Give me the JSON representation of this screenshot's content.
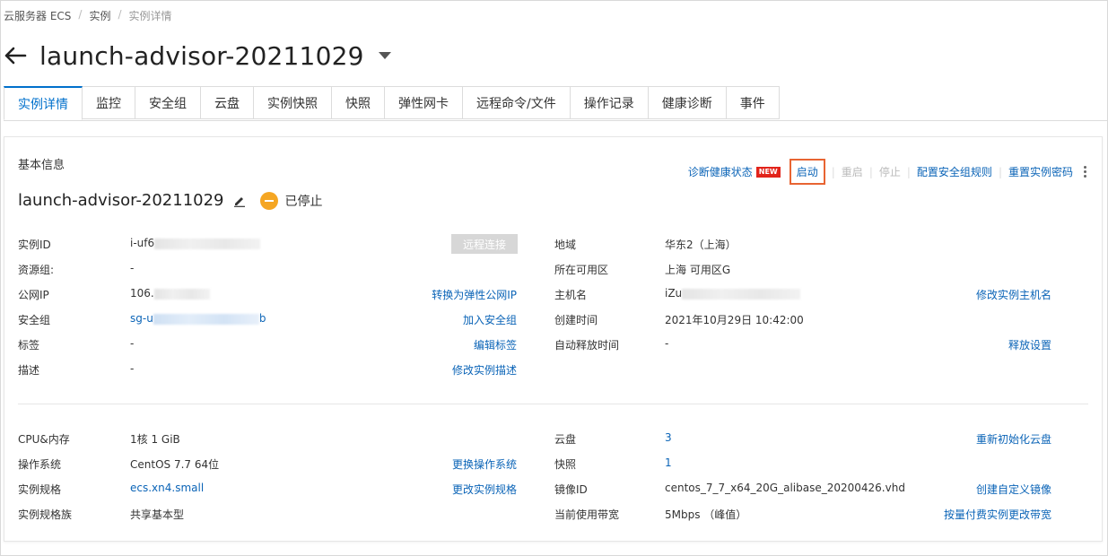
{
  "breadcrumb": [
    "云服务器 ECS",
    "实例",
    "实例详情"
  ],
  "page_title": "launch-advisor-20211029",
  "tabs": [
    "实例详情",
    "监控",
    "安全组",
    "云盘",
    "实例快照",
    "快照",
    "弹性网卡",
    "远程命令/文件",
    "操作记录",
    "健康诊断",
    "事件"
  ],
  "panel": {
    "title": "基本信息",
    "actions": {
      "diagnose": "诊断健康状态",
      "new_badge": "NEW",
      "start": "启动",
      "restart": "重启",
      "stop": "停止",
      "config_sg": "配置安全组规则",
      "reset_pwd": "重置实例密码"
    },
    "instance_name": "launch-advisor-20211029",
    "status": "已停止",
    "remote_connect": "远程连接",
    "left": {
      "instance_id_label": "实例ID",
      "instance_id_value": "i-uf6",
      "resource_group_label": "资源组:",
      "resource_group_value": "-",
      "public_ip_label": "公网IP",
      "public_ip_value": "106.",
      "public_ip_action": "转换为弹性公网IP",
      "sg_label": "安全组",
      "sg_value_prefix": "sg-u",
      "sg_value_suffix": "b",
      "sg_action": "加入安全组",
      "tag_label": "标签",
      "tag_value": "-",
      "tag_action": "编辑标签",
      "desc_label": "描述",
      "desc_value": "-",
      "desc_action": "修改实例描述"
    },
    "right": {
      "region_label": "地域",
      "region_value": "华东2（上海）",
      "zone_label": "所在可用区",
      "zone_value": "上海 可用区G",
      "hostname_label": "主机名",
      "hostname_value": "iZu",
      "hostname_action": "修改实例主机名",
      "created_label": "创建时间",
      "created_value": "2021年10月29日 10:42:00",
      "release_label": "自动释放时间",
      "release_value": "-",
      "release_action": "释放设置"
    },
    "spec_left": {
      "cpu_label": "CPU&内存",
      "cpu_value": "1核 1 GiB",
      "os_label": "操作系统",
      "os_value": "CentOS 7.7 64位",
      "os_action": "更换操作系统",
      "type_label": "实例规格",
      "type_value": "ecs.xn4.small",
      "type_action": "更改实例规格",
      "family_label": "实例规格族",
      "family_value": "共享基本型"
    },
    "spec_right": {
      "disk_label": "云盘",
      "disk_value": "3",
      "disk_action": "重新初始化云盘",
      "snapshot_label": "快照",
      "snapshot_value": "1",
      "image_label": "镜像ID",
      "image_value": "centos_7_7_x64_20G_alibase_20200426.vhd",
      "image_action": "创建自定义镜像",
      "bw_label": "当前使用带宽",
      "bw_value": "5Mbps （峰值）",
      "bw_action": "按量付费实例更改带宽"
    }
  },
  "colors": {
    "link": "#0b64b7",
    "active_tab": "#0070cc",
    "highlight": "#e86432",
    "status": "#f5a623",
    "new_badge": "#e2231a"
  }
}
